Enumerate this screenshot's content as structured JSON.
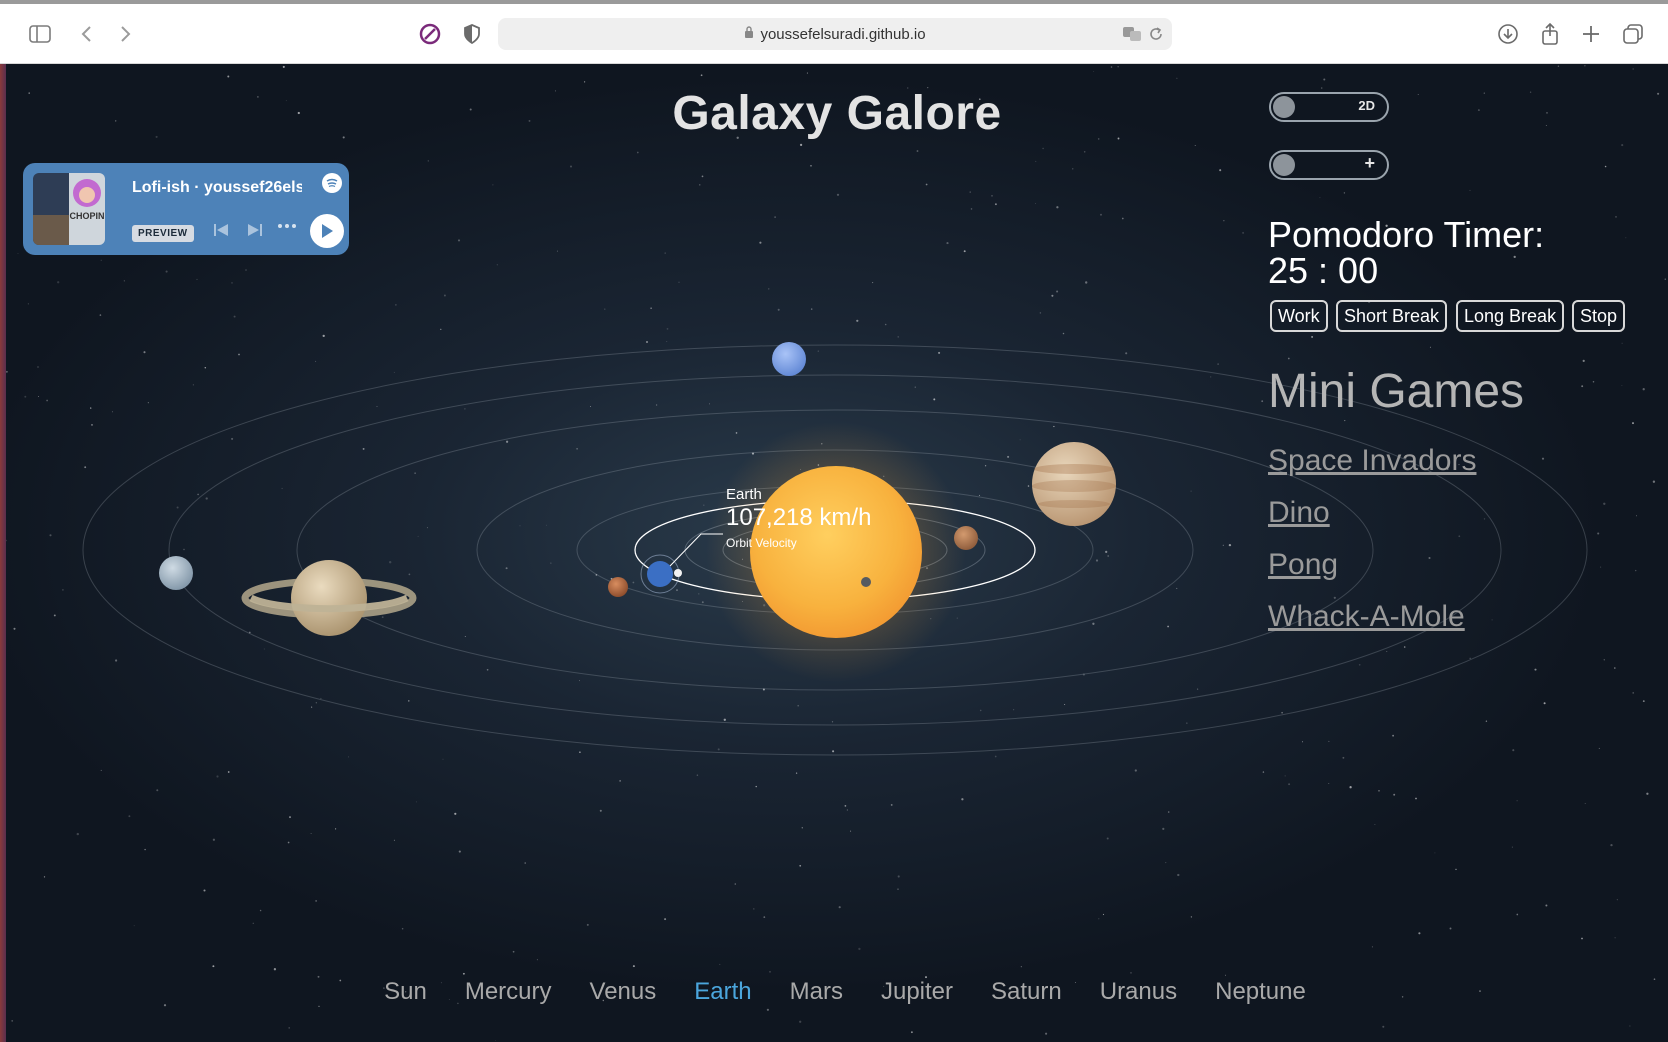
{
  "browser": {
    "url": "youssefelsuradi.github.io",
    "icons": [
      "sidebar-icon",
      "back-icon",
      "forward-icon",
      "privacy-icon",
      "shield-icon",
      "lock-icon",
      "translate-icon",
      "reload-icon",
      "download-icon",
      "share-icon",
      "new-tab-icon",
      "tabs-overview-icon"
    ]
  },
  "page": {
    "title": "Galaxy Galore"
  },
  "spotify": {
    "track": "Lofi-ish · youssef26els",
    "preview_label": "PREVIEW",
    "album_text": "CHOPIN"
  },
  "toggles": {
    "view_label": "2D",
    "zoom_label": "+"
  },
  "pomodoro": {
    "title": "Pomodoro Timer:",
    "time": "25 : 00",
    "buttons": [
      "Work",
      "Short Break",
      "Long Break",
      "Stop"
    ]
  },
  "mini_games": {
    "title": "Mini Games",
    "links": [
      "Space Invadors",
      "Dino",
      "Pong",
      "Whack-A-Mole"
    ]
  },
  "tooltip": {
    "planet": "Earth",
    "value": "107,218 km/h",
    "label": "Orbit Velocity"
  },
  "planet_nav": {
    "items": [
      "Sun",
      "Mercury",
      "Venus",
      "Earth",
      "Mars",
      "Jupiter",
      "Saturn",
      "Uranus",
      "Neptune"
    ],
    "active": "Earth"
  },
  "colors": {
    "active_nav": "#4ba6dd",
    "spotify_bg": "#4d82b8",
    "sun": "#f7b541"
  }
}
